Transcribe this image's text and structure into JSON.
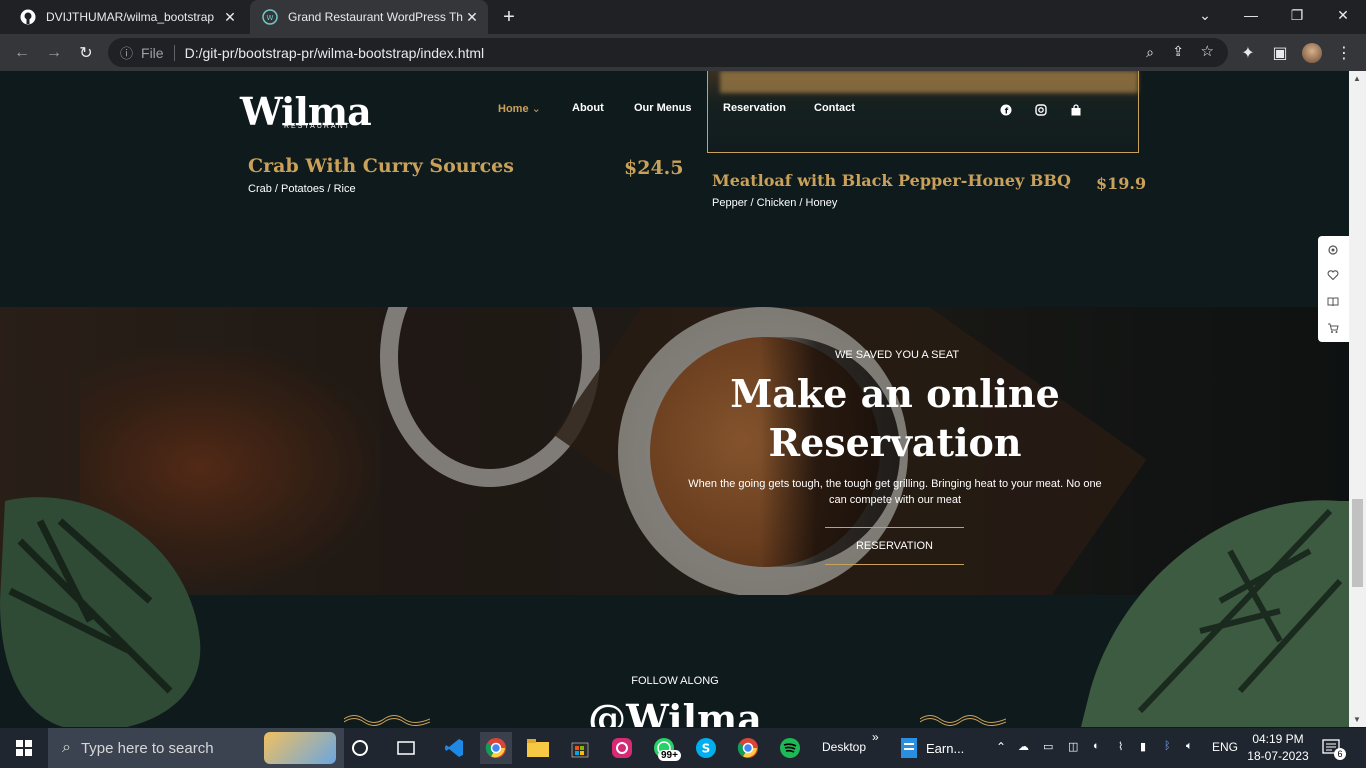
{
  "browser": {
    "tabs": [
      {
        "title": "DVIJTHUMAR/wilma_bootstrap",
        "active": false
      },
      {
        "title": "Grand Restaurant WordPress The",
        "active": true
      }
    ],
    "new_tab": "+",
    "address": {
      "scheme": "File",
      "url": "D:/git-pr/bootstrap-pr/wilma-bootstrap/index.html"
    }
  },
  "site": {
    "logo": "Wilma",
    "logo_sub": "RESTAURANT",
    "nav": [
      "Home",
      "About",
      "Our Menus",
      "Reservation",
      "Contact"
    ],
    "dishes": [
      {
        "name": "Crab With Curry Sources",
        "price": "$24.5",
        "ingredients": "Crab / Potatoes / Rice"
      },
      {
        "name": "Meatloaf with Black Pepper-Honey BBQ",
        "price": "$19.9",
        "ingredients": "Pepper / Chicken / Honey"
      }
    ],
    "reservation": {
      "eyebrow": "WE SAVED YOU A SEAT",
      "title_line1": "Make an online",
      "title_line2": "Reservation",
      "text": "When the going gets tough, the tough get grilling. Bringing heat to your meat. No one can compete with our meat",
      "button": "RESERVATION"
    },
    "follow": {
      "eyebrow": "FOLLOW ALONG",
      "handle": "@Wilma"
    }
  },
  "taskbar": {
    "search_placeholder": "Type here to search",
    "desktop_label": "Desktop",
    "earn_label": "Earn...",
    "whatsapp_badge": "99+",
    "language": "ENG",
    "time": "04:19 PM",
    "date": "18-07-2023",
    "notifications": "6"
  },
  "colors": {
    "accent": "#c9a15a",
    "page_bg": "#0f1a1c"
  }
}
